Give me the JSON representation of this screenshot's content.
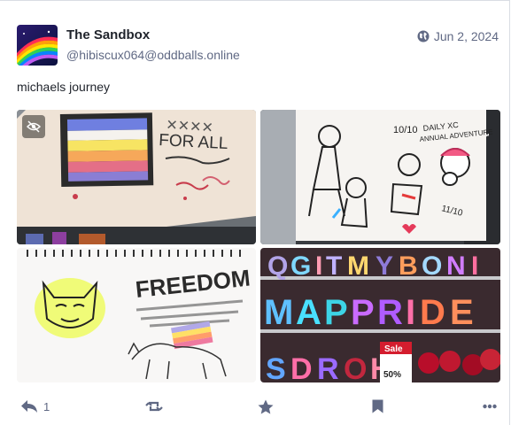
{
  "post": {
    "author": {
      "display_name": "The Sandbox",
      "handle": "@hibiscux064@oddballs.online",
      "avatar_icon": "rainbow-avatar"
    },
    "visibility_icon": "globe-icon",
    "date": "Jun 2, 2024",
    "content": "michaels journey",
    "media": [
      {
        "name": "drawing-flag-for-all",
        "sensitive_toggle_icon": "eye-slash-icon",
        "visible_text": "FOR ALL"
      },
      {
        "name": "drawing-characters",
        "visible_text": "10/10  DAILY XC ANNUAL ADVENTURE"
      },
      {
        "name": "drawing-freedom",
        "visible_text": "FREEDOM"
      },
      {
        "name": "balloon-letters-photo",
        "visible_text": "MAPPRIDE",
        "sale_sign": "Sale",
        "sale_percent": "50%"
      }
    ],
    "actions": {
      "reply_icon": "reply-icon",
      "reply_count": "1",
      "boost_icon": "boost-icon",
      "favourite_icon": "star-icon",
      "bookmark_icon": "bookmark-icon",
      "more_icon": "ellipsis-icon"
    }
  },
  "colors": {
    "text_primary": "#1f232b",
    "text_secondary": "#606984",
    "border": "#d9dde3"
  }
}
